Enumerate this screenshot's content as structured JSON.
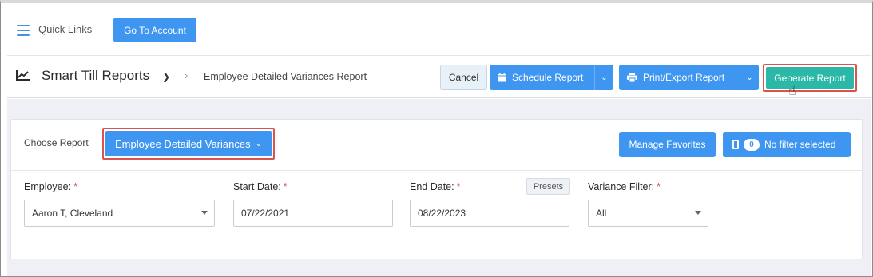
{
  "topbar": {
    "quick_links": "Quick Links",
    "go_account": "Go To Account"
  },
  "header": {
    "title": "Smart Till Reports",
    "breadcrumb": "Employee Detailed Variances Report",
    "cancel": "Cancel",
    "schedule": "Schedule Report",
    "print": "Print/Export Report",
    "generate": "Generate Report"
  },
  "card": {
    "choose_label": "Choose Report",
    "choose_value": "Employee Detailed Variances",
    "manage_favorites": "Manage Favorites",
    "filter_count": "0",
    "filter_label": "No filter selected",
    "presets": "Presets",
    "fields": {
      "employee": {
        "label": "Employee:",
        "value": "Aaron T, Cleveland"
      },
      "start_date": {
        "label": "Start Date:",
        "value": "07/22/2021"
      },
      "end_date": {
        "label": "End Date:",
        "value": "08/22/2023"
      },
      "variance_filter": {
        "label": "Variance Filter:",
        "value": "All"
      }
    },
    "required_mark": "*"
  },
  "colors": {
    "primary": "#3f96f0",
    "generate": "#2bb8a6",
    "highlight": "#d9534f",
    "background": "#eef0f5"
  }
}
